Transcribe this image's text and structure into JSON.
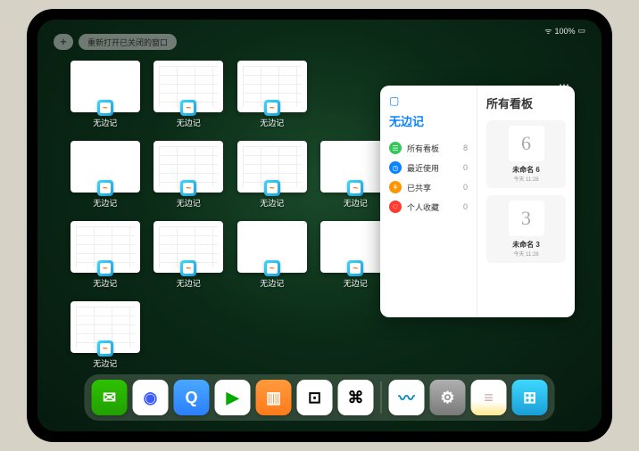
{
  "status": {
    "wifi": "ᯤ",
    "battery": "100%"
  },
  "topbar": {
    "add": "+",
    "reopen": "重新打开已关闭的窗口"
  },
  "app_label": "无边记",
  "windows": [
    {
      "style": "plain"
    },
    {
      "style": "grid"
    },
    {
      "style": "grid"
    },
    {
      "style": "plain"
    },
    {
      "style": "grid"
    },
    {
      "style": "grid"
    },
    {
      "style": "plain"
    },
    {
      "style": "grid"
    },
    {
      "style": "grid"
    },
    {
      "style": "plain"
    },
    {
      "style": "plain"
    },
    {
      "style": "grid"
    }
  ],
  "panel": {
    "app_icon": "▢",
    "title": "无边记",
    "right_title": "所有看板",
    "ellipsis": "⋯",
    "sidebar": [
      {
        "color": "#34c759",
        "icon": "☰",
        "label": "所有看板",
        "count": "8"
      },
      {
        "color": "#0a84ff",
        "icon": "◷",
        "label": "最近使用",
        "count": "0"
      },
      {
        "color": "#ff9500",
        "icon": "⚘",
        "label": "已共享",
        "count": "0"
      },
      {
        "color": "#ff3b30",
        "icon": "♡",
        "label": "个人收藏",
        "count": "0"
      }
    ],
    "boards": [
      {
        "sketch": "6",
        "name": "未命名 6",
        "time": "今天 11:28"
      },
      {
        "sketch": "3",
        "name": "未命名 3",
        "time": "今天 11:28"
      }
    ]
  },
  "dock": [
    {
      "name": "wechat",
      "bg": "linear-gradient(#2dc100,#22a000)",
      "glyph": "✉"
    },
    {
      "name": "quark",
      "bg": "#fff",
      "glyph": "◉",
      "fg": "#3b5bff"
    },
    {
      "name": "browser",
      "bg": "linear-gradient(#4aa8ff,#2b7fff)",
      "glyph": "Q"
    },
    {
      "name": "play",
      "bg": "#fff",
      "glyph": "▶",
      "fg": "#0a0"
    },
    {
      "name": "books",
      "bg": "linear-gradient(#ff9a3d,#ff7a1a)",
      "glyph": "▥"
    },
    {
      "name": "dice",
      "bg": "#fff",
      "glyph": "⊡",
      "fg": "#000"
    },
    {
      "name": "graph",
      "bg": "#fff",
      "glyph": "⌘",
      "fg": "#000"
    },
    {
      "name": "freeform",
      "bg": "#fff",
      "glyph": "〰",
      "fg": "#08c"
    },
    {
      "name": "settings",
      "bg": "linear-gradient(#b0b0b0,#7a7a7a)",
      "glyph": "⚙"
    },
    {
      "name": "notes",
      "bg": "linear-gradient(#fff 60%,#ffe88a)",
      "glyph": "≡",
      "fg": "#caa"
    },
    {
      "name": "folder",
      "bg": "linear-gradient(#3dd8ff,#1a9fd8)",
      "glyph": "⊞"
    }
  ]
}
